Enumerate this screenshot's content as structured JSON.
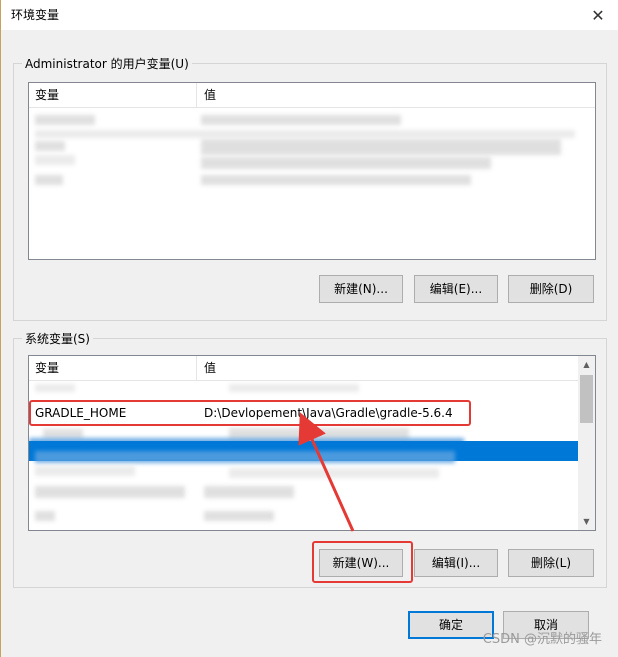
{
  "window": {
    "title": "环境变量",
    "close_glyph": "✕"
  },
  "user_vars": {
    "group_label": "Administrator 的用户变量(U)",
    "col_variable": "变量",
    "col_value": "值",
    "buttons": {
      "new": "新建(N)...",
      "edit": "编辑(E)...",
      "delete": "删除(D)"
    }
  },
  "system_vars": {
    "group_label": "系统变量(S)",
    "col_variable": "变量",
    "col_value": "值",
    "highlighted_row": {
      "variable": "GRADLE_HOME",
      "value": "D:\\Devlopement\\Java\\Gradle\\gradle-5.6.4"
    },
    "buttons": {
      "new": "新建(W)...",
      "edit": "编辑(I)...",
      "delete": "删除(L)"
    }
  },
  "footer": {
    "ok": "确定",
    "cancel": "取消"
  },
  "watermark": "CSDN @沉默的骚年",
  "colors": {
    "annotation": "#e53935",
    "selection": "#0078d7"
  },
  "icons": {
    "close": "close-icon",
    "scroll_up": "chevron-up-icon",
    "scroll_down": "chevron-down-icon"
  }
}
